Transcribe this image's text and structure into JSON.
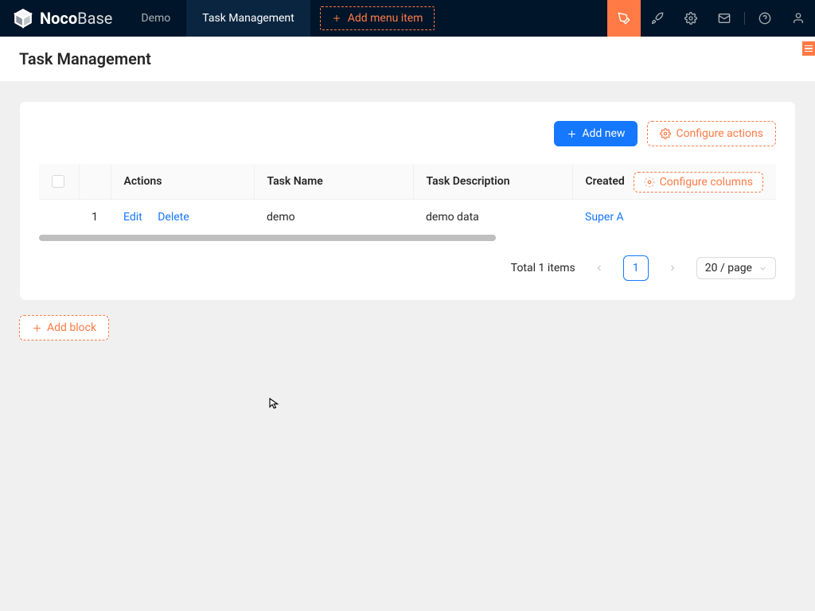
{
  "brand": {
    "bold": "Noco",
    "light": "Base"
  },
  "nav": {
    "tabs": [
      "Demo",
      "Task Management"
    ],
    "active": 1,
    "add_menu": "Add menu item"
  },
  "page": {
    "title": "Task Management"
  },
  "toolbar": {
    "add_new": "Add new",
    "configure_actions": "Configure actions"
  },
  "table": {
    "configure_columns": "Configure columns",
    "columns": [
      "Actions",
      "Task Name",
      "Task Description",
      "Created"
    ],
    "rows": [
      {
        "index": "1",
        "actions": [
          "Edit",
          "Delete"
        ],
        "name": "demo",
        "description": "demo data",
        "created_by": "Super A"
      }
    ]
  },
  "pagination": {
    "total_text": "Total 1 items",
    "current": "1",
    "page_size": "20 / page"
  },
  "add_block": "Add block"
}
